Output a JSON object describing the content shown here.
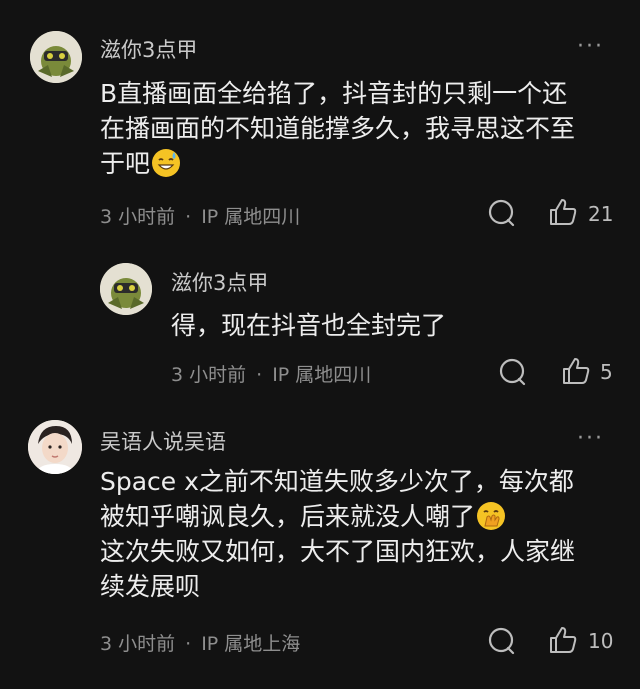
{
  "comments": [
    {
      "username": "滋你3点甲",
      "lines": [
        "B直播画面全给掐了，抖音封的只剩一个还",
        "在播画面的不知道能撑多久，我寻思这不至",
        "于吧"
      ],
      "emoji": "sweat-smile-emoji",
      "time": "3 小时前",
      "separator": "·",
      "location": "IP 属地四川",
      "likes": "21",
      "more": "···"
    },
    {
      "username": "滋你3点甲",
      "lines": [
        "得，现在抖音也全封完了"
      ],
      "time": "3 小时前",
      "separator": "·",
      "location": "IP 属地四川",
      "likes": "5"
    },
    {
      "username": "吴语人说吴语",
      "lines": [
        "Space x之前不知道失败多少次了，每次都",
        "被知乎嘲讽良久，后来就没人嘲了",
        "这次失败又如何，大不了国内狂欢，人家继",
        "续发展呗"
      ],
      "emoji": "hand-over-mouth-emoji",
      "time": "3 小时前",
      "separator": "·",
      "location": "IP 属地上海",
      "likes": "10",
      "more": "···"
    }
  ]
}
